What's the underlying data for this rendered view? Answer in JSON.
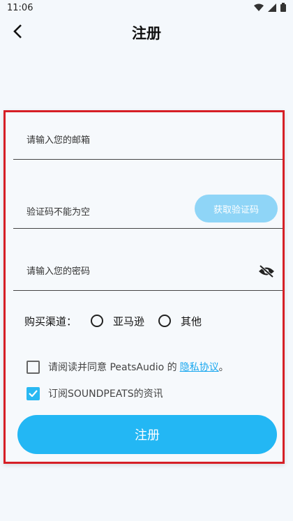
{
  "status_bar": {
    "time": "11:06"
  },
  "header": {
    "title": "注册"
  },
  "form": {
    "email_placeholder": "请输入您的邮箱",
    "code_placeholder": "验证码不能为空",
    "get_code_label": "获取验证码",
    "password_placeholder": "请输入您的密码",
    "channel_label": "购买渠道：",
    "channel_options": [
      "亚马逊",
      "其他"
    ],
    "agree_text": "请阅读并同意 PeatsAudio 的",
    "privacy_link": "隐私协议",
    "agree_suffix": "。",
    "agree_checked": false,
    "subscribe_text": "订阅SOUNDPEATS的资讯",
    "subscribe_checked": true,
    "submit_label": "注册"
  },
  "colors": {
    "accent": "#23b7f4",
    "code_button": "#8fd5f7",
    "highlight_border": "#d61f26"
  },
  "icons": [
    "back-arrow-icon",
    "wifi-icon",
    "signal-icon",
    "battery-icon",
    "eye-off-icon",
    "check-icon"
  ]
}
